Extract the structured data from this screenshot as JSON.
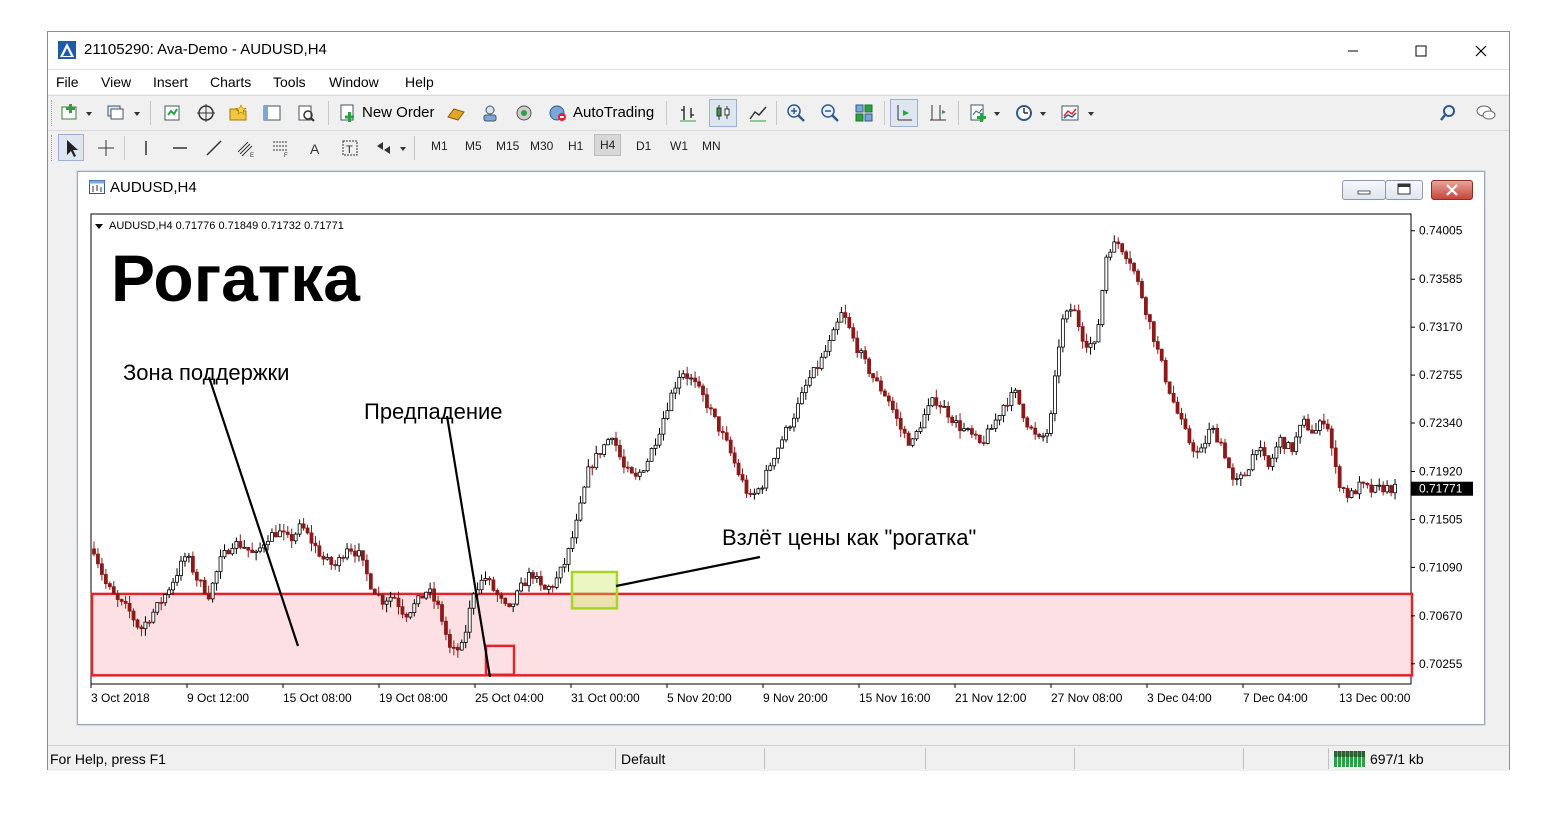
{
  "window": {
    "title": "21105290: Ava-Demo - AUDUSD,H4"
  },
  "menu": [
    "File",
    "View",
    "Insert",
    "Charts",
    "Tools",
    "Window",
    "Help"
  ],
  "toolbar": {
    "new_order": "New Order",
    "autotrading": "AutoTrading"
  },
  "timeframes": [
    "M1",
    "M5",
    "M15",
    "M30",
    "H1",
    "H4",
    "D1",
    "W1",
    "MN"
  ],
  "active_timeframe": "H4",
  "chart_window": {
    "title": "AUDUSD,H4"
  },
  "chart_data": {
    "type": "candlestick",
    "header": "AUDUSD,H4  0.71776 0.71849 0.71732 0.71771",
    "big_title": "Рогатка",
    "annotations": {
      "support_zone": "Зона поддержки",
      "false_break": "Предпадение",
      "slingshot": "Взлёт цены как \"рогатка\""
    },
    "y_ticks": [
      "0.74005",
      "0.73585",
      "0.73170",
      "0.72755",
      "0.72340",
      "0.71920",
      "0.71505",
      "0.71090",
      "0.70670",
      "0.70255"
    ],
    "y_tick_values": [
      0.74005,
      0.73585,
      0.7317,
      0.72755,
      0.7234,
      0.7192,
      0.71505,
      0.7109,
      0.7067,
      0.70255
    ],
    "x_ticks": [
      "3 Oct 2018",
      "9 Oct 12:00",
      "15 Oct 08:00",
      "19 Oct 08:00",
      "25 Oct 04:00",
      "31 Oct 00:00",
      "5 Nov 20:00",
      "9 Nov 20:00",
      "15 Nov 16:00",
      "21 Nov 12:00",
      "27 Nov 08:00",
      "3 Dec 04:00",
      "7 Dec 04:00",
      "13 Dec 00:00"
    ],
    "current_price": "0.71771",
    "ylim": [
      0.7008,
      0.7415
    ],
    "colors": {
      "bull": "#000000",
      "bear": "#8b1a1a",
      "zone_fill": "#fde0e3",
      "zone_border": "#e0262b",
      "false_break_box": "#e0262b",
      "slingshot_box": "#a8d42a"
    },
    "close_path": [
      0.7125,
      0.7095,
      0.708,
      0.7072,
      0.7055,
      0.7068,
      0.7082,
      0.71,
      0.712,
      0.7098,
      0.7085,
      0.7115,
      0.713,
      0.7128,
      0.7118,
      0.7135,
      0.714,
      0.7132,
      0.7145,
      0.713,
      0.7115,
      0.711,
      0.7128,
      0.712,
      0.7095,
      0.708,
      0.7085,
      0.7068,
      0.7078,
      0.709,
      0.7072,
      0.7035,
      0.704,
      0.709,
      0.71,
      0.7085,
      0.707,
      0.709,
      0.7105,
      0.7088,
      0.7095,
      0.7115,
      0.715,
      0.7195,
      0.721,
      0.7225,
      0.7195,
      0.7185,
      0.72,
      0.7225,
      0.7255,
      0.728,
      0.727,
      0.7255,
      0.7235,
      0.7215,
      0.719,
      0.7168,
      0.718,
      0.7205,
      0.7225,
      0.7245,
      0.727,
      0.7285,
      0.7305,
      0.733,
      0.7305,
      0.7285,
      0.7268,
      0.7255,
      0.723,
      0.7215,
      0.7238,
      0.7255,
      0.7245,
      0.7232,
      0.7225,
      0.7215,
      0.723,
      0.725,
      0.726,
      0.7235,
      0.7218,
      0.7228,
      0.732,
      0.7335,
      0.7305,
      0.73,
      0.7385,
      0.739,
      0.7375,
      0.7345,
      0.731,
      0.7275,
      0.7245,
      0.722,
      0.7205,
      0.723,
      0.7215,
      0.718,
      0.719,
      0.7215,
      0.7195,
      0.722,
      0.721,
      0.7235,
      0.7225,
      0.724,
      0.7185,
      0.717,
      0.718,
      0.7175,
      0.7178,
      0.7177
    ]
  },
  "status": {
    "help": "For Help, press F1",
    "profile": "Default",
    "traffic": "697/1 kb"
  }
}
